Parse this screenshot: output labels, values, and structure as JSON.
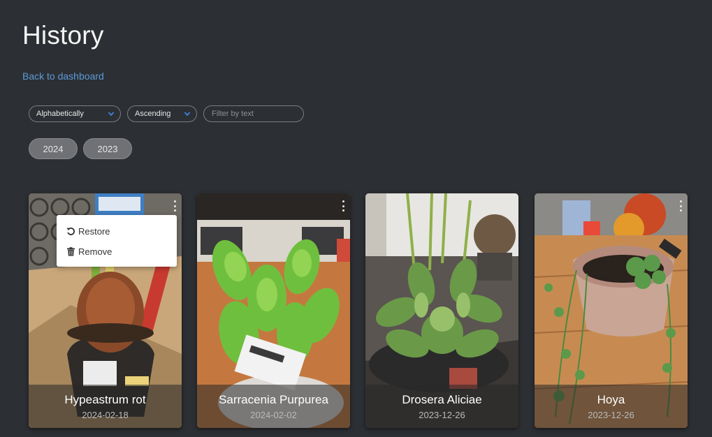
{
  "header": {
    "title": "History",
    "back_link": "Back to dashboard"
  },
  "controls": {
    "sort_value": "Alphabetically",
    "order_value": "Ascending",
    "filter_placeholder": "Filter by text"
  },
  "years": [
    "2024",
    "2023"
  ],
  "menu": {
    "restore_label": "Restore",
    "remove_label": "Remove"
  },
  "cards": [
    {
      "name": "Hypeastrum rot",
      "date": "2024-02-18"
    },
    {
      "name": "Sarracenia Purpurea",
      "date": "2024-02-02"
    },
    {
      "name": "Drosera Aliciae",
      "date": "2023-12-26"
    },
    {
      "name": "Hoya",
      "date": "2023-12-26"
    }
  ],
  "colors": {
    "background": "#2c2f33",
    "link": "#5b9bd9",
    "chip": "#6f7175"
  },
  "icons": {
    "menu": "kebab-icon",
    "restore": "restore-icon",
    "remove": "trash-icon",
    "select": "chevron-down-icon"
  }
}
